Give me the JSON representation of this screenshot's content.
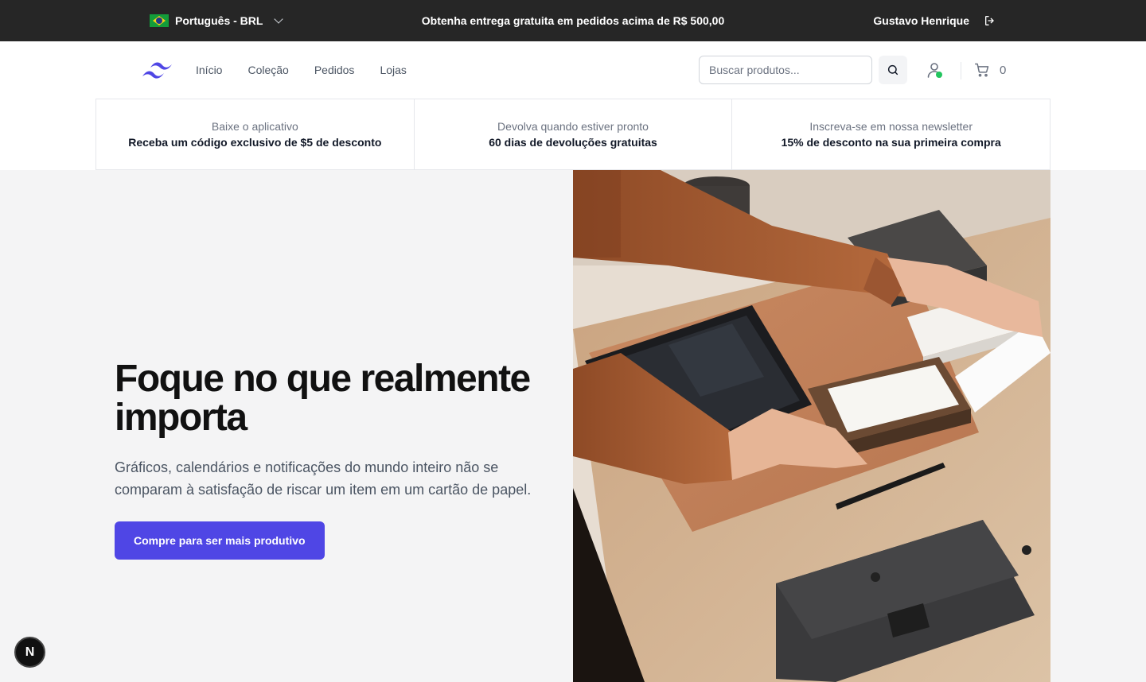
{
  "topbar": {
    "language": "Português - BRL",
    "promo": "Obtenha entrega gratuita em pedidos acima de R$ 500,00",
    "user_name": "Gustavo Henrique"
  },
  "nav": {
    "items": [
      {
        "label": "Início"
      },
      {
        "label": "Coleção"
      },
      {
        "label": "Pedidos"
      },
      {
        "label": "Lojas"
      }
    ],
    "search_placeholder": "Buscar produtos...",
    "cart_count": "0"
  },
  "perks": [
    {
      "title": "Baixe o aplicativo",
      "desc": "Receba um código exclusivo de $5 de desconto"
    },
    {
      "title": "Devolva quando estiver pronto",
      "desc": "60 dias de devoluções gratuitas"
    },
    {
      "title": "Inscreva-se em nossa newsletter",
      "desc": "15% de desconto na sua primeira compra"
    }
  ],
  "hero": {
    "title": "Foque no que realmente importa",
    "description": "Gráficos, calendários e notificações do mundo inteiro não se comparam à satisfação de riscar um item em um cartão de papel.",
    "cta": "Compre para ser mais produtivo"
  },
  "badge": {
    "letter": "N"
  },
  "colors": {
    "topbar_bg": "#262626",
    "accent": "#4f46e5",
    "hero_bg": "#f4f4f5",
    "online": "#22c55e"
  },
  "icons": [
    "brazil-flag-icon",
    "chevron-down-icon",
    "logout-icon",
    "logo-waves-icon",
    "search-icon",
    "user-icon",
    "cart-icon",
    "nextjs-icon"
  ]
}
